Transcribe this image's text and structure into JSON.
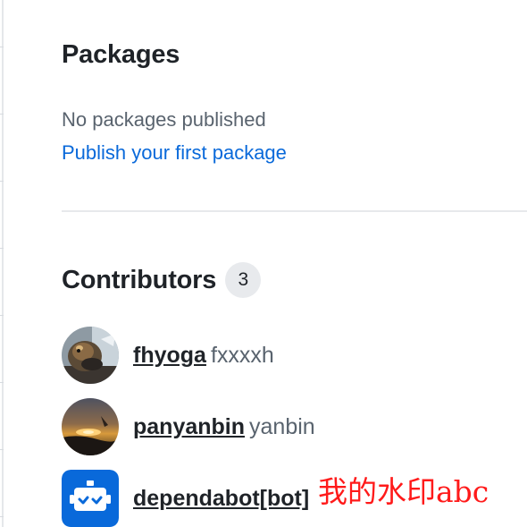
{
  "packages": {
    "title": "Packages",
    "empty_text": "No packages published",
    "publish_link": "Publish your first package"
  },
  "contributors": {
    "title": "Contributors",
    "count": "3",
    "items": [
      {
        "login": "fhyoga",
        "name": "fxxxxh",
        "avatar": "hamster-photo"
      },
      {
        "login": "panyanbin",
        "name": "yanbin",
        "avatar": "sunset-photo"
      },
      {
        "login": "dependabot[bot]",
        "name": "",
        "avatar": "dependabot-robot-icon"
      }
    ]
  },
  "watermark": "我的水印abc",
  "colors": {
    "text": "#1f2328",
    "muted": "#59636e",
    "link": "#0969da",
    "badge_bg": "#e8eaed",
    "dependabot_bg": "#0969da",
    "watermark": "#ff1a1a"
  }
}
